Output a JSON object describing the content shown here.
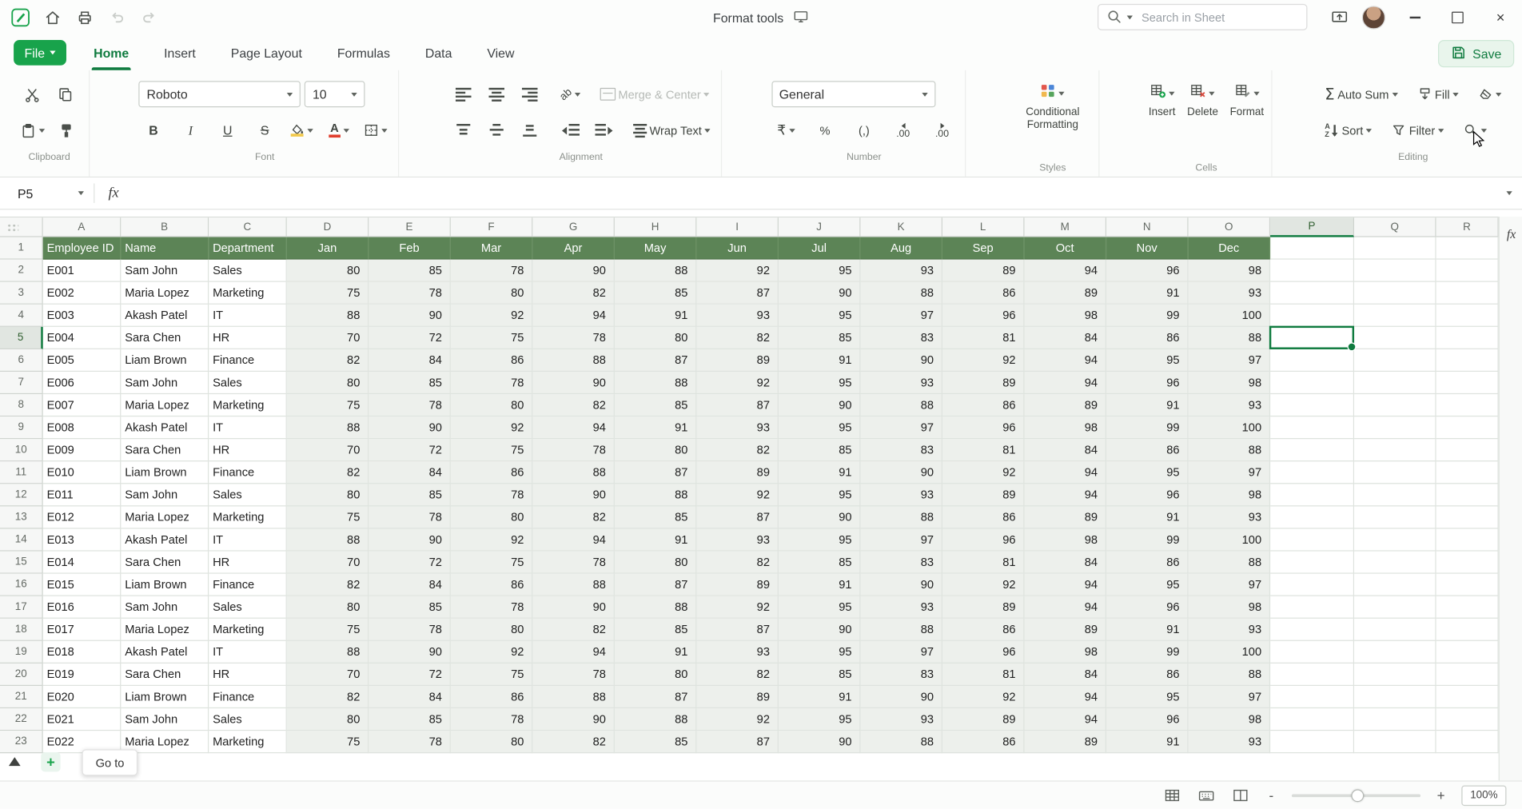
{
  "titlebar": {
    "title": "Format tools",
    "search_placeholder": "Search in Sheet"
  },
  "menubar": {
    "file_label": "File",
    "tabs": [
      "Home",
      "Insert",
      "Page Layout",
      "Formulas",
      "Data",
      "View"
    ],
    "active_tab": "Home",
    "save_label": "Save"
  },
  "ribbon": {
    "clipboard": {
      "label": "Clipboard"
    },
    "font": {
      "label": "Font",
      "family": "Roboto",
      "size": "10",
      "bold": "B",
      "italic": "I",
      "underline": "U",
      "strike": "S",
      "color_letter": "A"
    },
    "alignment": {
      "label": "Alignment",
      "orientation": "ab",
      "merge_center": "Merge & Center",
      "wrap_text": "Wrap Text"
    },
    "number": {
      "label": "Number",
      "format": "General",
      "currency": "₹",
      "percent": "%",
      "comma": "(,)",
      "inc_decimal": ".00",
      "dec_decimal": ".00"
    },
    "styles": {
      "label": "Styles",
      "conditional_formatting": "Conditional Formatting"
    },
    "cells": {
      "label": "Cells",
      "insert": "Insert",
      "delete": "Delete",
      "format": "Format"
    },
    "editing": {
      "label": "Editing",
      "autosum": "Auto Sum",
      "fill": "Fill",
      "sort": "Sort",
      "filter": "Filter"
    }
  },
  "formula_bar": {
    "cell_ref": "P5",
    "fx": "fx"
  },
  "sheet": {
    "col_letters": [
      "A",
      "B",
      "C",
      "D",
      "E",
      "F",
      "G",
      "H",
      "I",
      "J",
      "K",
      "L",
      "M",
      "N",
      "O",
      "P",
      "Q",
      "R"
    ],
    "header_row": [
      "Employee ID",
      "Name",
      "Department",
      "Jan",
      "Feb",
      "Mar",
      "Apr",
      "May",
      "Jun",
      "Jul",
      "Aug",
      "Sep",
      "Oct",
      "Nov",
      "Dec"
    ],
    "rows": [
      [
        "E001",
        "Sam John",
        "Sales",
        80,
        85,
        78,
        90,
        88,
        92,
        95,
        93,
        89,
        94,
        96,
        98
      ],
      [
        "E002",
        "Maria Lopez",
        "Marketing",
        75,
        78,
        80,
        82,
        85,
        87,
        90,
        88,
        86,
        89,
        91,
        93
      ],
      [
        "E003",
        "Akash Patel",
        "IT",
        88,
        90,
        92,
        94,
        91,
        93,
        95,
        97,
        96,
        98,
        99,
        100
      ],
      [
        "E004",
        "Sara Chen",
        "HR",
        70,
        72,
        75,
        78,
        80,
        82,
        85,
        83,
        81,
        84,
        86,
        88
      ],
      [
        "E005",
        "Liam Brown",
        "Finance",
        82,
        84,
        86,
        88,
        87,
        89,
        91,
        90,
        92,
        94,
        95,
        97
      ],
      [
        "E006",
        "Sam John",
        "Sales",
        80,
        85,
        78,
        90,
        88,
        92,
        95,
        93,
        89,
        94,
        96,
        98
      ],
      [
        "E007",
        "Maria Lopez",
        "Marketing",
        75,
        78,
        80,
        82,
        85,
        87,
        90,
        88,
        86,
        89,
        91,
        93
      ],
      [
        "E008",
        "Akash Patel",
        "IT",
        88,
        90,
        92,
        94,
        91,
        93,
        95,
        97,
        96,
        98,
        99,
        100
      ],
      [
        "E009",
        "Sara Chen",
        "HR",
        70,
        72,
        75,
        78,
        80,
        82,
        85,
        83,
        81,
        84,
        86,
        88
      ],
      [
        "E010",
        "Liam Brown",
        "Finance",
        82,
        84,
        86,
        88,
        87,
        89,
        91,
        90,
        92,
        94,
        95,
        97
      ],
      [
        "E011",
        "Sam John",
        "Sales",
        80,
        85,
        78,
        90,
        88,
        92,
        95,
        93,
        89,
        94,
        96,
        98
      ],
      [
        "E012",
        "Maria Lopez",
        "Marketing",
        75,
        78,
        80,
        82,
        85,
        87,
        90,
        88,
        86,
        89,
        91,
        93
      ],
      [
        "E013",
        "Akash Patel",
        "IT",
        88,
        90,
        92,
        94,
        91,
        93,
        95,
        97,
        96,
        98,
        99,
        100
      ],
      [
        "E014",
        "Sara Chen",
        "HR",
        70,
        72,
        75,
        78,
        80,
        82,
        85,
        83,
        81,
        84,
        86,
        88
      ],
      [
        "E015",
        "Liam Brown",
        "Finance",
        82,
        84,
        86,
        88,
        87,
        89,
        91,
        90,
        92,
        94,
        95,
        97
      ],
      [
        "E016",
        "Sam John",
        "Sales",
        80,
        85,
        78,
        90,
        88,
        92,
        95,
        93,
        89,
        94,
        96,
        98
      ],
      [
        "E017",
        "Maria Lopez",
        "Marketing",
        75,
        78,
        80,
        82,
        85,
        87,
        90,
        88,
        86,
        89,
        91,
        93
      ],
      [
        "E018",
        "Akash Patel",
        "IT",
        88,
        90,
        92,
        94,
        91,
        93,
        95,
        97,
        96,
        98,
        99,
        100
      ],
      [
        "E019",
        "Sara Chen",
        "HR",
        70,
        72,
        75,
        78,
        80,
        82,
        85,
        83,
        81,
        84,
        86,
        88
      ],
      [
        "E020",
        "Liam Brown",
        "Finance",
        82,
        84,
        86,
        88,
        87,
        89,
        91,
        90,
        92,
        94,
        95,
        97
      ],
      [
        "E021",
        "Sam John",
        "Sales",
        80,
        85,
        78,
        90,
        88,
        92,
        95,
        93,
        89,
        94,
        96,
        98
      ],
      [
        "E022",
        "Maria Lopez",
        "Marketing",
        75,
        78,
        80,
        82,
        85,
        87,
        90,
        88,
        86,
        89,
        91,
        93
      ]
    ],
    "selected_cell": "P5",
    "selected_col": "P",
    "selected_row": 5
  },
  "side_rail": {
    "fx": "fx"
  },
  "floats": {
    "go_to": "Go to"
  },
  "statusbar": {
    "zoom": "100%"
  },
  "icons": {
    "sigma": "Σ",
    "plus": "+",
    "close": "×",
    "zoom_out": "-",
    "zoom_in": "+",
    "sort_a": "A",
    "sort_z": "Z"
  }
}
